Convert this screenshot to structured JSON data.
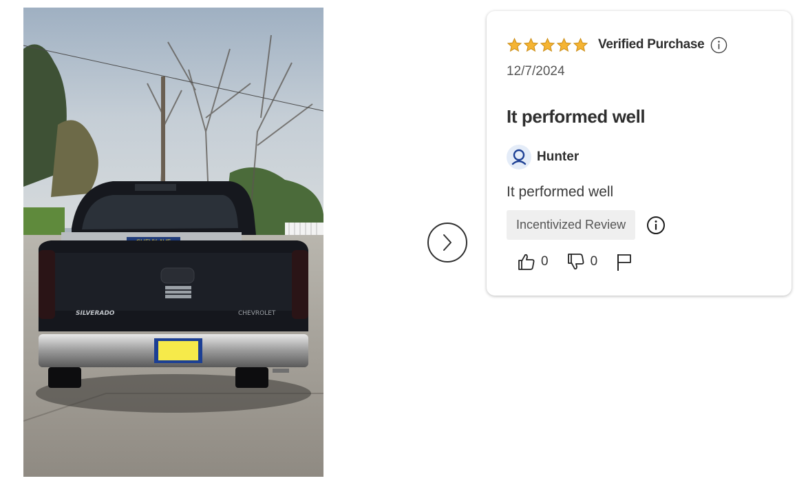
{
  "gallery": {
    "photo_alt": "Customer photo",
    "next_label": "Next image"
  },
  "review": {
    "rating": 5,
    "rating_max": 5,
    "verified_label": "Verified Purchase",
    "date": "12/7/2024",
    "title": "It performed well",
    "reviewer": "Hunter",
    "body": "It performed well",
    "incentivized_label": "Incentivized Review",
    "helpful_count": "0",
    "not_helpful_count": "0"
  },
  "icons": {
    "star": "star-icon",
    "info": "info-icon",
    "user": "user-icon",
    "thumbs_up": "thumbs-up-icon",
    "thumbs_down": "thumbs-down-icon",
    "flag": "flag-icon",
    "next": "chevron-right-icon"
  },
  "colors": {
    "star": "#f5b433",
    "star_outline": "#c98a12",
    "avatar_bg": "#e4ecf8",
    "user_icon": "#1c3f94",
    "badge_bg": "#efefef"
  }
}
